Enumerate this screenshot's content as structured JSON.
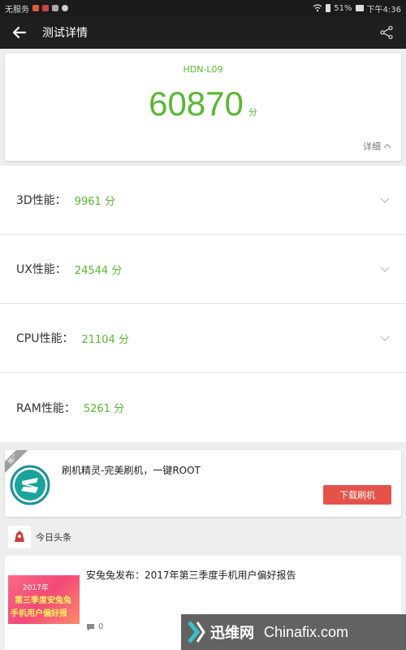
{
  "status_bar": {
    "carrier": "无服务",
    "battery": "51%",
    "time": "下午4:36"
  },
  "app_bar": {
    "title": "测试详情"
  },
  "score_card": {
    "device": "HDN-L09",
    "score": "60870",
    "unit": "分",
    "detail_label": "详细"
  },
  "metrics": [
    {
      "label": "3D性能：",
      "value": "9961 分"
    },
    {
      "label": "UX性能：",
      "value": "24544 分"
    },
    {
      "label": "CPU性能：",
      "value": "21104 分"
    },
    {
      "label": "RAM性能：",
      "value": "5261 分"
    }
  ],
  "ad": {
    "badge": "推广",
    "title": "刷机精灵-完美刷机，一键ROOT",
    "button_label": "下载刷机"
  },
  "news": {
    "source": "今日头条",
    "title": "安兔兔发布：2017年第三季度手机用户偏好报告",
    "comments": "0",
    "thumb_lines": [
      "2017年",
      "第三季度安兔兔",
      "手机用户偏好报"
    ]
  },
  "watermark": {
    "cn": "迅维网",
    "en": "Chinafix.com"
  },
  "colors": {
    "accent_green": "#59b830",
    "button_red": "#e5524a",
    "app_bar": "#1f1f1f"
  }
}
